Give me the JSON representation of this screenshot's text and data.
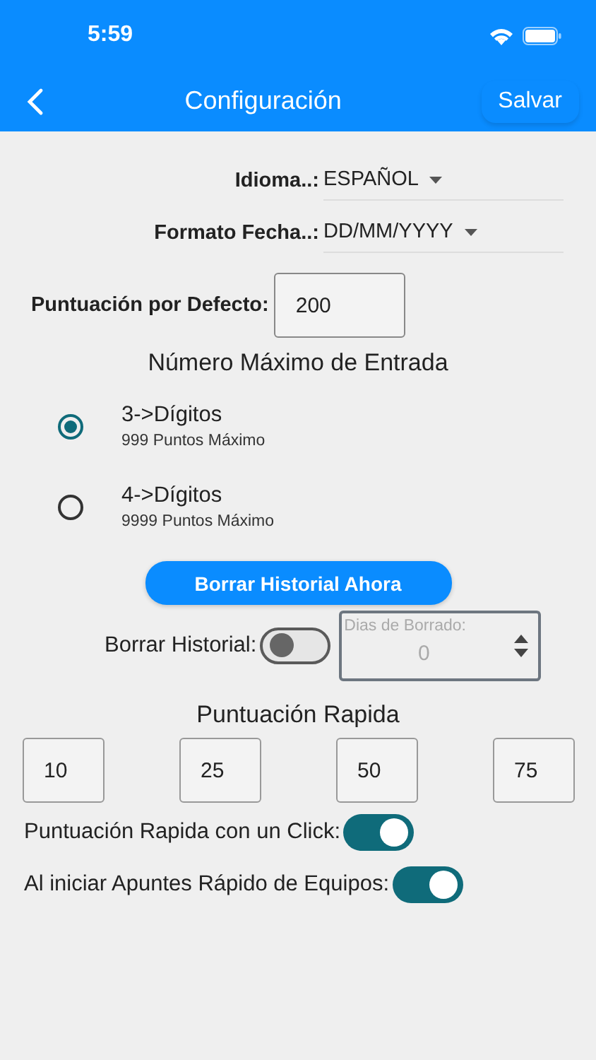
{
  "status_bar": {
    "time": "5:59"
  },
  "header": {
    "title": "Configuración",
    "action": "Salvar"
  },
  "dropdowns": [
    {
      "label": "Idioma..:",
      "value": "ESPAÑOL"
    },
    {
      "label": "Formato Fecha..:",
      "value": "DD/MM/YYYY"
    }
  ],
  "default_score": {
    "label": "Puntuación por Defecto:",
    "value": "200"
  },
  "max_entry": {
    "title": "Número Máximo de Entrada",
    "options": [
      {
        "label": "3->Dígitos",
        "sublabel": "999 Puntos Máximo",
        "selected": true
      },
      {
        "label": "4->Dígitos",
        "sublabel": "9999 Puntos Máximo",
        "selected": false
      }
    ]
  },
  "clear_button": "Borrar Historial Ahora",
  "clear_history": {
    "label": "Borrar Historial:",
    "on": false,
    "days": {
      "label": "Dias de Borrado:",
      "value": "0",
      "disabled": true
    }
  },
  "quick_score": {
    "title": "Puntuación Rapida",
    "values": [
      "10",
      "25",
      "50",
      "75"
    ]
  },
  "toggles": [
    {
      "label": "Puntuación Rapida con un Click:",
      "on": true
    },
    {
      "label": "Al iniciar Apuntes Rápido de Equipos:",
      "on": true
    }
  ]
}
